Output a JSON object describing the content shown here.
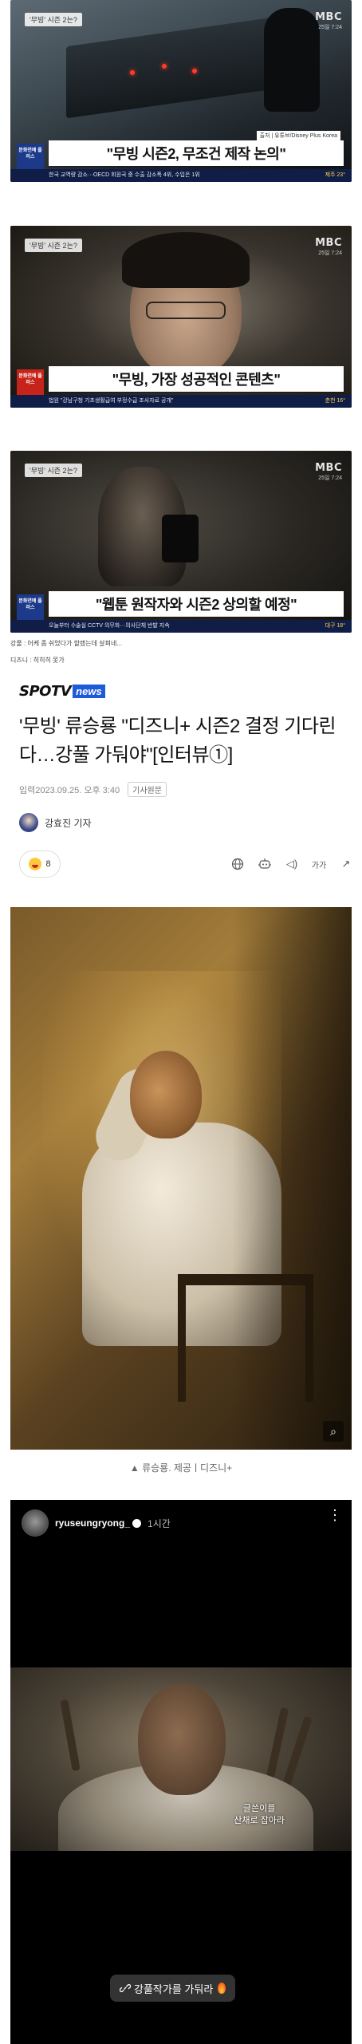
{
  "tv_frames": [
    {
      "topic": "'무빙' 시즌 2는?",
      "channel": "MBC",
      "time": "25일 7:24",
      "source": "출처 | 유튜브/Disney Plus Korea",
      "sidebox": "문화연예 플러스",
      "caption": "\"무빙 시즌2, 무조건 제작 논의\"",
      "ticker": "한국 교역량 감소···OECD 회원국 중 수출 감소폭 4위, 수입은 1위",
      "weather": "제주 23°"
    },
    {
      "topic": "'무빙' 시즌 2는?",
      "channel": "MBC",
      "time": "25일 7:24",
      "source": "",
      "sidebox": "문화연예 플러스",
      "caption": "\"무빙, 가장 성공적인 콘텐츠\"",
      "ticker": "법원 \"강남구청 기초생활급여 부정수급 조사자료 공개\"",
      "weather": "춘천 16°"
    },
    {
      "topic": "'무빙' 시즌 2는?",
      "channel": "MBC",
      "time": "25일 7:24",
      "source": "",
      "sidebox": "문화연예 플러스",
      "caption": "\"웹툰 원작자와 시즌2 상의할 예정\"",
      "ticker": "오늘부터 수술실 CCTV 의무화···의사단체 반발 지속",
      "weather": "대구 18°"
    }
  ],
  "comments": [
    "강풀 : 어케 좀 쉬었다가 할랬는데 살펴네...",
    "디즈니 : 히히히 못가"
  ],
  "article": {
    "brand_left": "SPOTV",
    "brand_right": "news",
    "headline": "'무빙' 류승룡 \"디즈니+ 시즌2 결정 기다린다…강풀 가둬야\"[인터뷰①]",
    "date": "입력2023.09.25. 오후 3:40",
    "original_button": "기사원문",
    "reporter": "강효진 기자",
    "reaction_count": "8",
    "tools": {
      "globe": "globe-icon",
      "sound_glyph": "◁)",
      "font_glyph": "가가",
      "share_glyph": "↗"
    }
  },
  "photo": {
    "caption": "▲ 류승룡. 제공ㅣ디즈니+",
    "zoom_glyph": "⌕"
  },
  "story": {
    "username": "ryuseungryong_",
    "time": "1시간",
    "subtitle_line1": "글쓴이를",
    "subtitle_line2": "산채로 잡아라",
    "link_text": "강풀작가를 가둬라"
  }
}
